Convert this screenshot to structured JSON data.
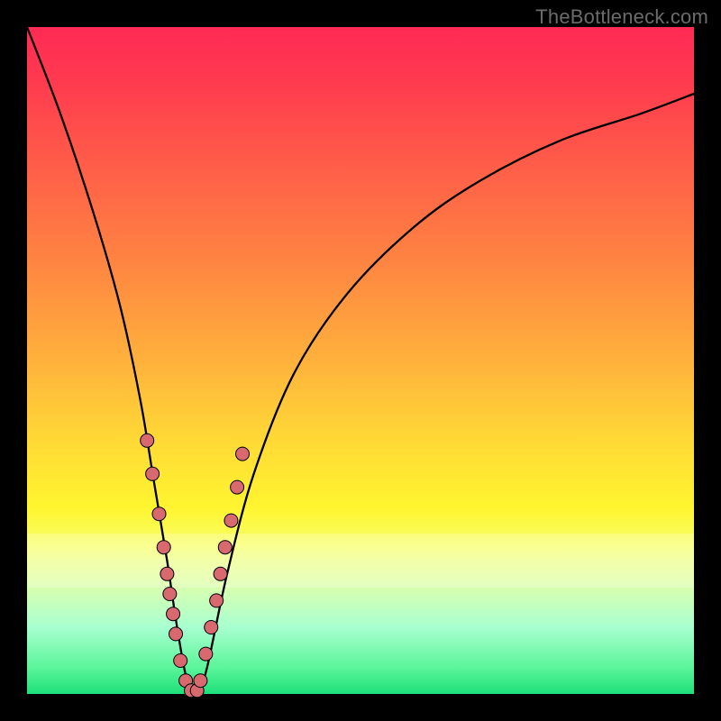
{
  "watermark": "TheBottleneck.com",
  "colors": {
    "frame": "#000000",
    "dot_fill": "#d86a6f",
    "dot_stroke": "#000000",
    "curve": "#000000"
  },
  "chart_data": {
    "type": "line",
    "title": "",
    "xlabel": "",
    "ylabel": "",
    "xlim": [
      0,
      100
    ],
    "ylim": [
      0,
      100
    ],
    "grid": false,
    "legend": false,
    "series": [
      {
        "name": "bottleneck-curve",
        "x": [
          0,
          5,
          10,
          14,
          17,
          19,
          21,
          22.5,
          24,
          25.5,
          27,
          30,
          34,
          40,
          48,
          58,
          68,
          80,
          92,
          100
        ],
        "y": [
          100,
          87,
          72,
          58,
          44,
          32,
          20,
          10,
          2,
          0,
          4,
          18,
          33,
          48,
          60,
          70,
          77,
          83,
          87,
          90
        ]
      }
    ],
    "dots": {
      "name": "sample-points",
      "x": [
        18.0,
        18.8,
        19.8,
        20.5,
        21.0,
        21.4,
        21.9,
        22.3,
        23.0,
        23.8,
        24.6,
        25.5,
        26.0,
        26.8,
        27.6,
        28.4,
        29.0,
        29.7,
        30.6,
        31.5,
        32.3
      ],
      "y": [
        38,
        33,
        27,
        22,
        18,
        15,
        12,
        9,
        5,
        2,
        0.5,
        0.5,
        2,
        6,
        10,
        14,
        18,
        22,
        26,
        31,
        36
      ]
    }
  }
}
